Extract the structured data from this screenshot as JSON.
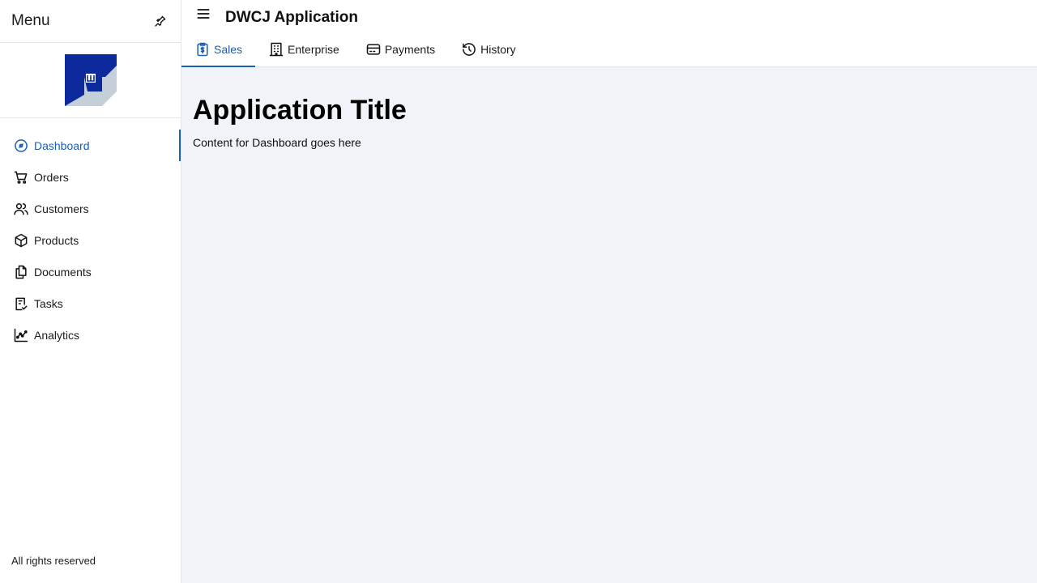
{
  "drawer": {
    "title": "Menu",
    "footer": "All rights reserved",
    "items": [
      {
        "label": "Dashboard",
        "icon": "dashboard-icon",
        "active": true
      },
      {
        "label": "Orders",
        "icon": "cart-icon"
      },
      {
        "label": "Customers",
        "icon": "users-icon"
      },
      {
        "label": "Products",
        "icon": "box-icon"
      },
      {
        "label": "Documents",
        "icon": "documents-icon"
      },
      {
        "label": "Tasks",
        "icon": "tasks-icon"
      },
      {
        "label": "Analytics",
        "icon": "analytics-icon"
      }
    ]
  },
  "header": {
    "title": "DWCJ Application",
    "tabs": [
      {
        "label": "Sales",
        "icon": "sales-icon",
        "active": true
      },
      {
        "label": "Enterprise",
        "icon": "building-icon"
      },
      {
        "label": "Payments",
        "icon": "credit-card-icon"
      },
      {
        "label": "History",
        "icon": "history-icon"
      }
    ]
  },
  "main": {
    "heading": "Application Title",
    "content": "Content for Dashboard goes here"
  },
  "colors": {
    "accent": "#1a5fb4",
    "content_bg": "#f0f3f8",
    "logo_dark": "#0d2a9c",
    "logo_light": "#c5cfd9"
  }
}
